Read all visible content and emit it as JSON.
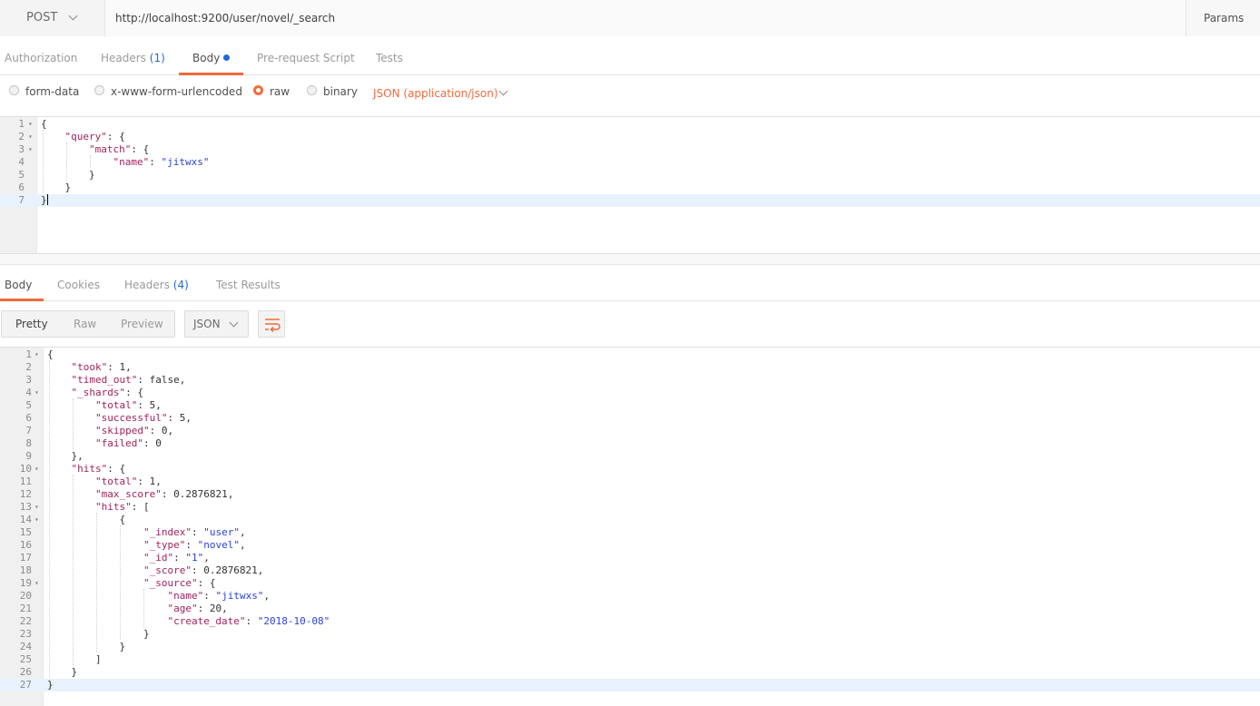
{
  "urlbar": {
    "method": "POST",
    "url": "http://localhost:9200/user/novel/_search",
    "params_label": "Params"
  },
  "request_tabs": [
    {
      "label": "Authorization",
      "count": "",
      "active": false
    },
    {
      "label": "Headers",
      "count": "(1)",
      "active": false
    },
    {
      "label": "Body",
      "count": "",
      "active": true,
      "dot": true
    },
    {
      "label": "Pre-request Script",
      "count": "",
      "active": false
    },
    {
      "label": "Tests",
      "count": "",
      "active": false
    }
  ],
  "body_types": {
    "options": [
      "form-data",
      "x-www-form-urlencoded",
      "raw",
      "binary"
    ],
    "selected": "raw",
    "content_type": "JSON (application/json)"
  },
  "request_body": {
    "active_line": 7,
    "lines": [
      {
        "n": "1",
        "fold": true,
        "html": "{"
      },
      {
        "n": "2",
        "fold": true,
        "html": "    <span class='k'>\"query\"</span>: {"
      },
      {
        "n": "3",
        "fold": true,
        "html": "        <span class='k'>\"match\"</span>: {"
      },
      {
        "n": "4",
        "fold": false,
        "html": "            <span class='k'>\"name\"</span>: <span class='s'>\"jitwxs\"</span>"
      },
      {
        "n": "5",
        "fold": false,
        "html": "        }"
      },
      {
        "n": "6",
        "fold": false,
        "html": "    }"
      },
      {
        "n": "7",
        "fold": false,
        "html": "}<span class='cursor'></span>"
      }
    ]
  },
  "response_tabs": [
    {
      "label": "Body",
      "count": "",
      "active": true
    },
    {
      "label": "Cookies",
      "count": "",
      "active": false
    },
    {
      "label": "Headers",
      "count": "(4)",
      "active": false
    },
    {
      "label": "Test Results",
      "count": "",
      "active": false
    }
  ],
  "response_toolbar": {
    "views": [
      "Pretty",
      "Raw",
      "Preview"
    ],
    "active_view": "Pretty",
    "format": "JSON",
    "wrap_icon": "wrap-lines-icon"
  },
  "response_body": {
    "active_line": 27,
    "lines": [
      {
        "n": "1",
        "fold": true,
        "html": "{"
      },
      {
        "n": "2",
        "fold": false,
        "html": "    <span class='k'>\"took\"</span>: 1,"
      },
      {
        "n": "3",
        "fold": false,
        "html": "    <span class='k'>\"timed_out\"</span>: false,"
      },
      {
        "n": "4",
        "fold": true,
        "html": "    <span class='k'>\"_shards\"</span>: {"
      },
      {
        "n": "5",
        "fold": false,
        "html": "        <span class='k'>\"total\"</span>: 5,"
      },
      {
        "n": "6",
        "fold": false,
        "html": "        <span class='k'>\"successful\"</span>: 5,"
      },
      {
        "n": "7",
        "fold": false,
        "html": "        <span class='k'>\"skipped\"</span>: 0,"
      },
      {
        "n": "8",
        "fold": false,
        "html": "        <span class='k'>\"failed\"</span>: 0"
      },
      {
        "n": "9",
        "fold": false,
        "html": "    },"
      },
      {
        "n": "10",
        "fold": true,
        "html": "    <span class='k'>\"hits\"</span>: {"
      },
      {
        "n": "11",
        "fold": false,
        "html": "        <span class='k'>\"total\"</span>: 1,"
      },
      {
        "n": "12",
        "fold": false,
        "html": "        <span class='k'>\"max_score\"</span>: 0.2876821,"
      },
      {
        "n": "13",
        "fold": true,
        "html": "        <span class='k'>\"hits\"</span>: ["
      },
      {
        "n": "14",
        "fold": true,
        "html": "            {"
      },
      {
        "n": "15",
        "fold": false,
        "html": "                <span class='k'>\"_index\"</span>: <span class='s'>\"user\"</span>,"
      },
      {
        "n": "16",
        "fold": false,
        "html": "                <span class='k'>\"_type\"</span>: <span class='s'>\"novel\"</span>,"
      },
      {
        "n": "17",
        "fold": false,
        "html": "                <span class='k'>\"_id\"</span>: <span class='s'>\"1\"</span>,"
      },
      {
        "n": "18",
        "fold": false,
        "html": "                <span class='k'>\"_score\"</span>: 0.2876821,"
      },
      {
        "n": "19",
        "fold": true,
        "html": "                <span class='k'>\"_source\"</span>: {"
      },
      {
        "n": "20",
        "fold": false,
        "html": "                    <span class='k'>\"name\"</span>: <span class='s'>\"jitwxs\"</span>,"
      },
      {
        "n": "21",
        "fold": false,
        "html": "                    <span class='k'>\"age\"</span>: 20,"
      },
      {
        "n": "22",
        "fold": false,
        "html": "                    <span class='k'>\"create_date\"</span>: <span class='s'>\"2018-10-08\"</span>"
      },
      {
        "n": "23",
        "fold": false,
        "html": "                }"
      },
      {
        "n": "24",
        "fold": false,
        "html": "            }"
      },
      {
        "n": "25",
        "fold": false,
        "html": "        ]"
      },
      {
        "n": "26",
        "fold": false,
        "html": "    }"
      },
      {
        "n": "27",
        "fold": false,
        "html": "}"
      }
    ]
  },
  "colors": {
    "accent": "#f26b3a",
    "link_blue": "#1f6bd8",
    "json_key": "#a3225b",
    "json_string": "#2a42d9",
    "active_line": "#e8f2fd"
  }
}
